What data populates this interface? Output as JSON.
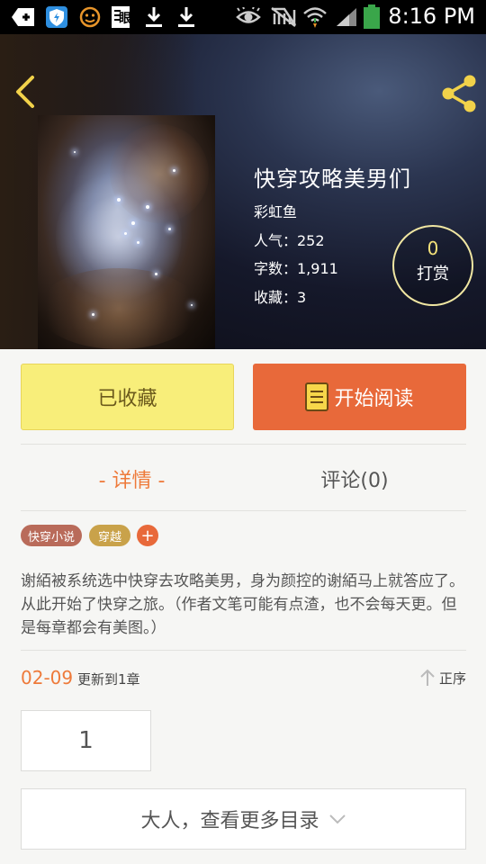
{
  "status_bar": {
    "time": "8:16 PM",
    "icons": [
      "add-icon",
      "shield-icon",
      "face-icon",
      "news-icon",
      "download-icon",
      "download-icon",
      "eye-icon",
      "mute-icon",
      "wifi-icon",
      "signal-icon",
      "battery-icon"
    ],
    "news_glyph": "眼"
  },
  "book": {
    "title": "快穿攻略美男们",
    "author": "彩虹鱼",
    "popularity": "人气：252",
    "word_count": "字数：1,911",
    "favorites": "收藏：3"
  },
  "tip": {
    "count": "0",
    "label": "打赏"
  },
  "actions": {
    "collected_label": "已收藏",
    "read_label": "开始阅读"
  },
  "tabs": {
    "details": "- 详情 -",
    "comments": "评论(0)"
  },
  "tags": [
    {
      "label": "快穿小说",
      "color": "#b96b5a"
    },
    {
      "label": "穿越",
      "color": "#c9a24a"
    }
  ],
  "tag_add": "+",
  "synopsis": "谢絔被系统选中快穿去攻略美男，身为颜控的谢絔马上就答应了。从此开始了快穿之旅。（作者文笔可能有点渣，也不会每天更。但是每章都会有美图。）",
  "updates": {
    "date": "02-09",
    "text": "更新到1章",
    "sort_label": "正序"
  },
  "chapter_number": "1",
  "more_catalog": "大人，查看更多目录",
  "colors": {
    "accent": "#e8693a",
    "collected_bg": "#f8ee7a",
    "tip_border": "#f0e6a2"
  }
}
